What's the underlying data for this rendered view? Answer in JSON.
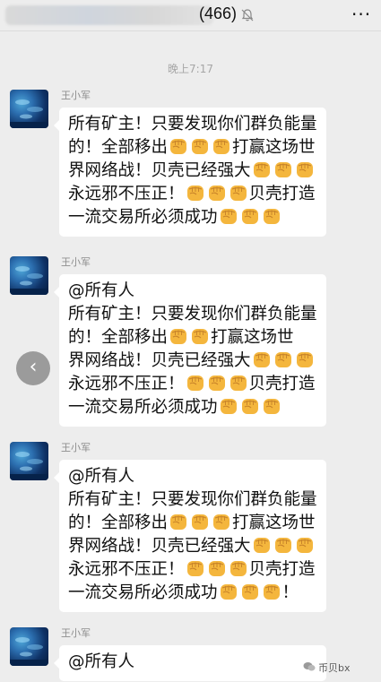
{
  "header": {
    "group_count": "(466)",
    "mute_icon": "bell-off-icon",
    "more_icon": "more-dots-icon",
    "more_label": "···"
  },
  "chat": {
    "timestamp": "晚上7:17",
    "fist_icon": "raised-fist-emoji",
    "messages": [
      {
        "sender": "王小军",
        "lines": [
          [
            {
              "t": "所有矿主！只要发现你们群负能量"
            }
          ],
          [
            {
              "t": "的！全部移出"
            },
            {
              "e": 3
            },
            {
              "t": "打赢这场世"
            }
          ],
          [
            {
              "t": "界网络战！贝壳已经强大"
            },
            {
              "e": 3
            }
          ],
          [
            {
              "t": "永远邪不压正！"
            },
            {
              "e": 3
            },
            {
              "t": "贝壳打造"
            }
          ],
          [
            {
              "t": "一流交易所必须成功"
            },
            {
              "e": 3
            }
          ]
        ]
      },
      {
        "sender": "王小军",
        "lines": [
          [
            {
              "t": "@所有人"
            }
          ],
          [
            {
              "t": "所有矿主！只要发现你们群负能量"
            }
          ],
          [
            {
              "t": "的！全部移出"
            },
            {
              "e": 2
            },
            {
              "t": "打赢这场世"
            }
          ],
          [
            {
              "t": "界网络战！贝壳已经强大"
            },
            {
              "e": 3
            }
          ],
          [
            {
              "t": "永远邪不压正！"
            },
            {
              "e": 3
            },
            {
              "t": "贝壳打造"
            }
          ],
          [
            {
              "t": "一流交易所必须成功"
            },
            {
              "e": 3
            }
          ]
        ]
      },
      {
        "sender": "王小军",
        "lines": [
          [
            {
              "t": "@所有人"
            }
          ],
          [
            {
              "t": "所有矿主！只要发现你们群负能量"
            }
          ],
          [
            {
              "t": "的！全部移出"
            },
            {
              "e": 3
            },
            {
              "t": "打赢这场世"
            }
          ],
          [
            {
              "t": "界网络战！贝壳已经强大"
            },
            {
              "e": 3
            }
          ],
          [
            {
              "t": "永远邪不压正！"
            },
            {
              "e": 3
            },
            {
              "t": "贝壳打造"
            }
          ],
          [
            {
              "t": "一流交易所必须成功"
            },
            {
              "e": 3
            },
            {
              "t": "！"
            }
          ]
        ]
      },
      {
        "sender": "王小军",
        "lines": [
          [
            {
              "t": "@所有人"
            }
          ]
        ]
      }
    ]
  },
  "nav": {
    "back_icon": "chevron-left-icon",
    "back_label": "‹"
  },
  "watermark": {
    "icon": "wechat-icon",
    "text": "币贝bx"
  },
  "colors": {
    "background": "#ededed",
    "bubble": "#ffffff",
    "fist": "#f4b63d"
  }
}
